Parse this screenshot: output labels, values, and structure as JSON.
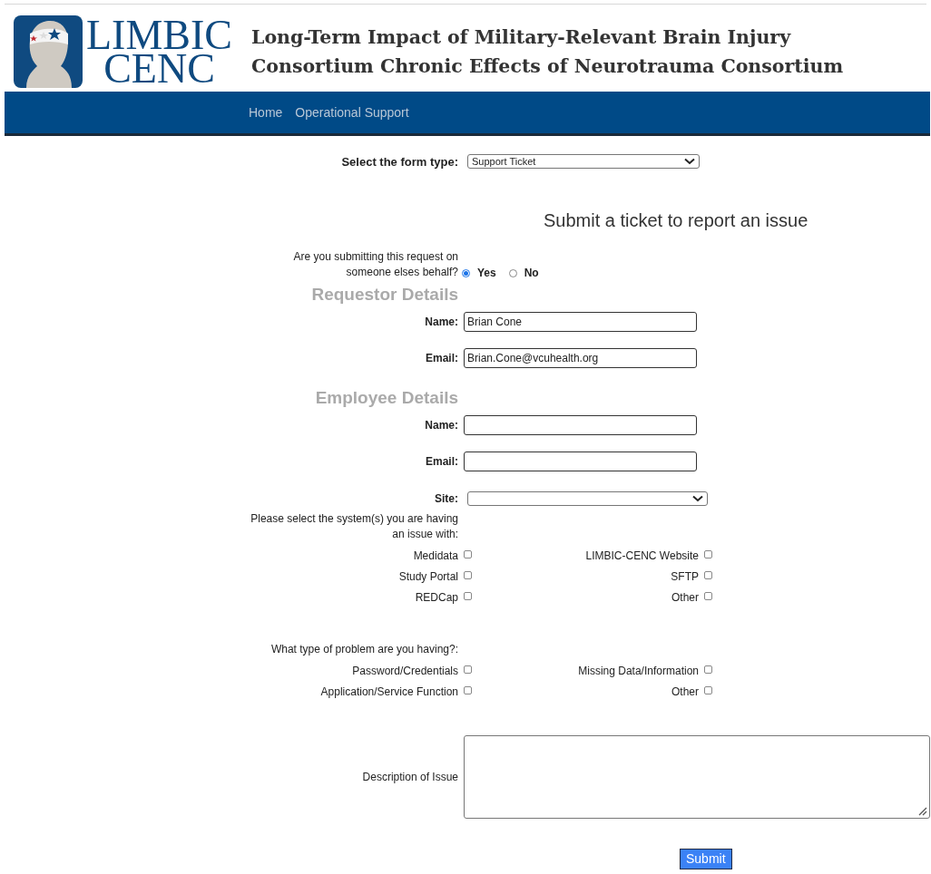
{
  "header": {
    "logo_lines": [
      "LIMBIC",
      "CENC"
    ],
    "title_lines": [
      "Long-Term Impact of Military-Relevant Brain Injury",
      "Consortium Chronic Effects of Neurotrauma Consortium"
    ]
  },
  "nav": [
    {
      "label": "Home"
    },
    {
      "label": "Operational Support"
    }
  ],
  "form_type": {
    "label": "Select the form type:",
    "value": "Support Ticket"
  },
  "heading": "Submit a ticket to report an issue",
  "behalf": {
    "question": "Are you submitting this request on someone elses behalf?",
    "options": [
      {
        "label": "Yes",
        "selected": true
      },
      {
        "label": "No",
        "selected": false
      }
    ]
  },
  "requestor": {
    "title": "Requestor Details",
    "fields": [
      {
        "label": "Name:",
        "value": "Brian Cone"
      },
      {
        "label": "Email:",
        "value": "Brian.Cone@vcuhealth.org"
      }
    ]
  },
  "employee": {
    "title": "Employee Details",
    "fields": [
      {
        "label": "Name:"
      },
      {
        "label": "Email:"
      }
    ],
    "site": {
      "label": "Site:"
    }
  },
  "systems": {
    "prompt": "Please select the system(s) you are having an issue with:",
    "options": [
      {
        "label": "Medidata",
        "checked": false
      },
      {
        "label": "LIMBIC-CENC Website",
        "checked": false
      },
      {
        "label": "Study Portal",
        "checked": false
      },
      {
        "label": "SFTP",
        "checked": false
      },
      {
        "label": "REDCap",
        "checked": false
      },
      {
        "label": "Other",
        "checked": false
      }
    ]
  },
  "problems": {
    "prompt": "What type of problem are you having?:",
    "options": [
      {
        "label": "Password/Credentials",
        "checked": false
      },
      {
        "label": "Missing Data/Information",
        "checked": false
      },
      {
        "label": "Application/Service Function",
        "checked": false
      },
      {
        "label": "Other",
        "checked": false
      }
    ]
  },
  "description": {
    "label": "Description of Issue"
  },
  "submit": {
    "label": "Submit"
  }
}
